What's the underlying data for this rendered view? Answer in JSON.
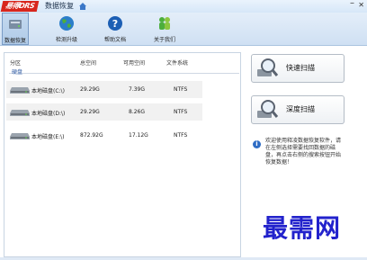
{
  "app": {
    "title": "数据恢复",
    "logo_text": "易得DRS"
  },
  "toolbar": [
    {
      "label": "数据恢复",
      "active": true
    },
    {
      "label": "检测升级",
      "active": false
    },
    {
      "label": "帮助文档",
      "active": false
    },
    {
      "label": "关于我们",
      "active": false
    }
  ],
  "table": {
    "columns": [
      "分区",
      "总空间",
      "可用空间",
      "文件系统"
    ],
    "group_label": "硬盘",
    "rows": [
      {
        "name": "本地磁盘(C:\\)",
        "total": "29.29G",
        "free": "7.39G",
        "fs": "NTFS"
      },
      {
        "name": "本地磁盘(D:\\)",
        "total": "29.29G",
        "free": "8.26G",
        "fs": "NTFS"
      },
      {
        "name": "本地磁盘(E:\\)",
        "total": "872.92G",
        "free": "17.12G",
        "fs": "NTFS"
      }
    ]
  },
  "actions": {
    "quick_scan": "快速扫描",
    "deep_scan": "深度扫描"
  },
  "info": "欢迎使用释凌数据恢复软件，请在左侧选择需要找回数据的磁盘，再点击右侧的搜索按钮开始恢复数据！",
  "watermark": "最需网",
  "colors": {
    "accent": "#2e6cc4",
    "logo": "#d8261d",
    "toolbar": "#d6e7f8"
  }
}
